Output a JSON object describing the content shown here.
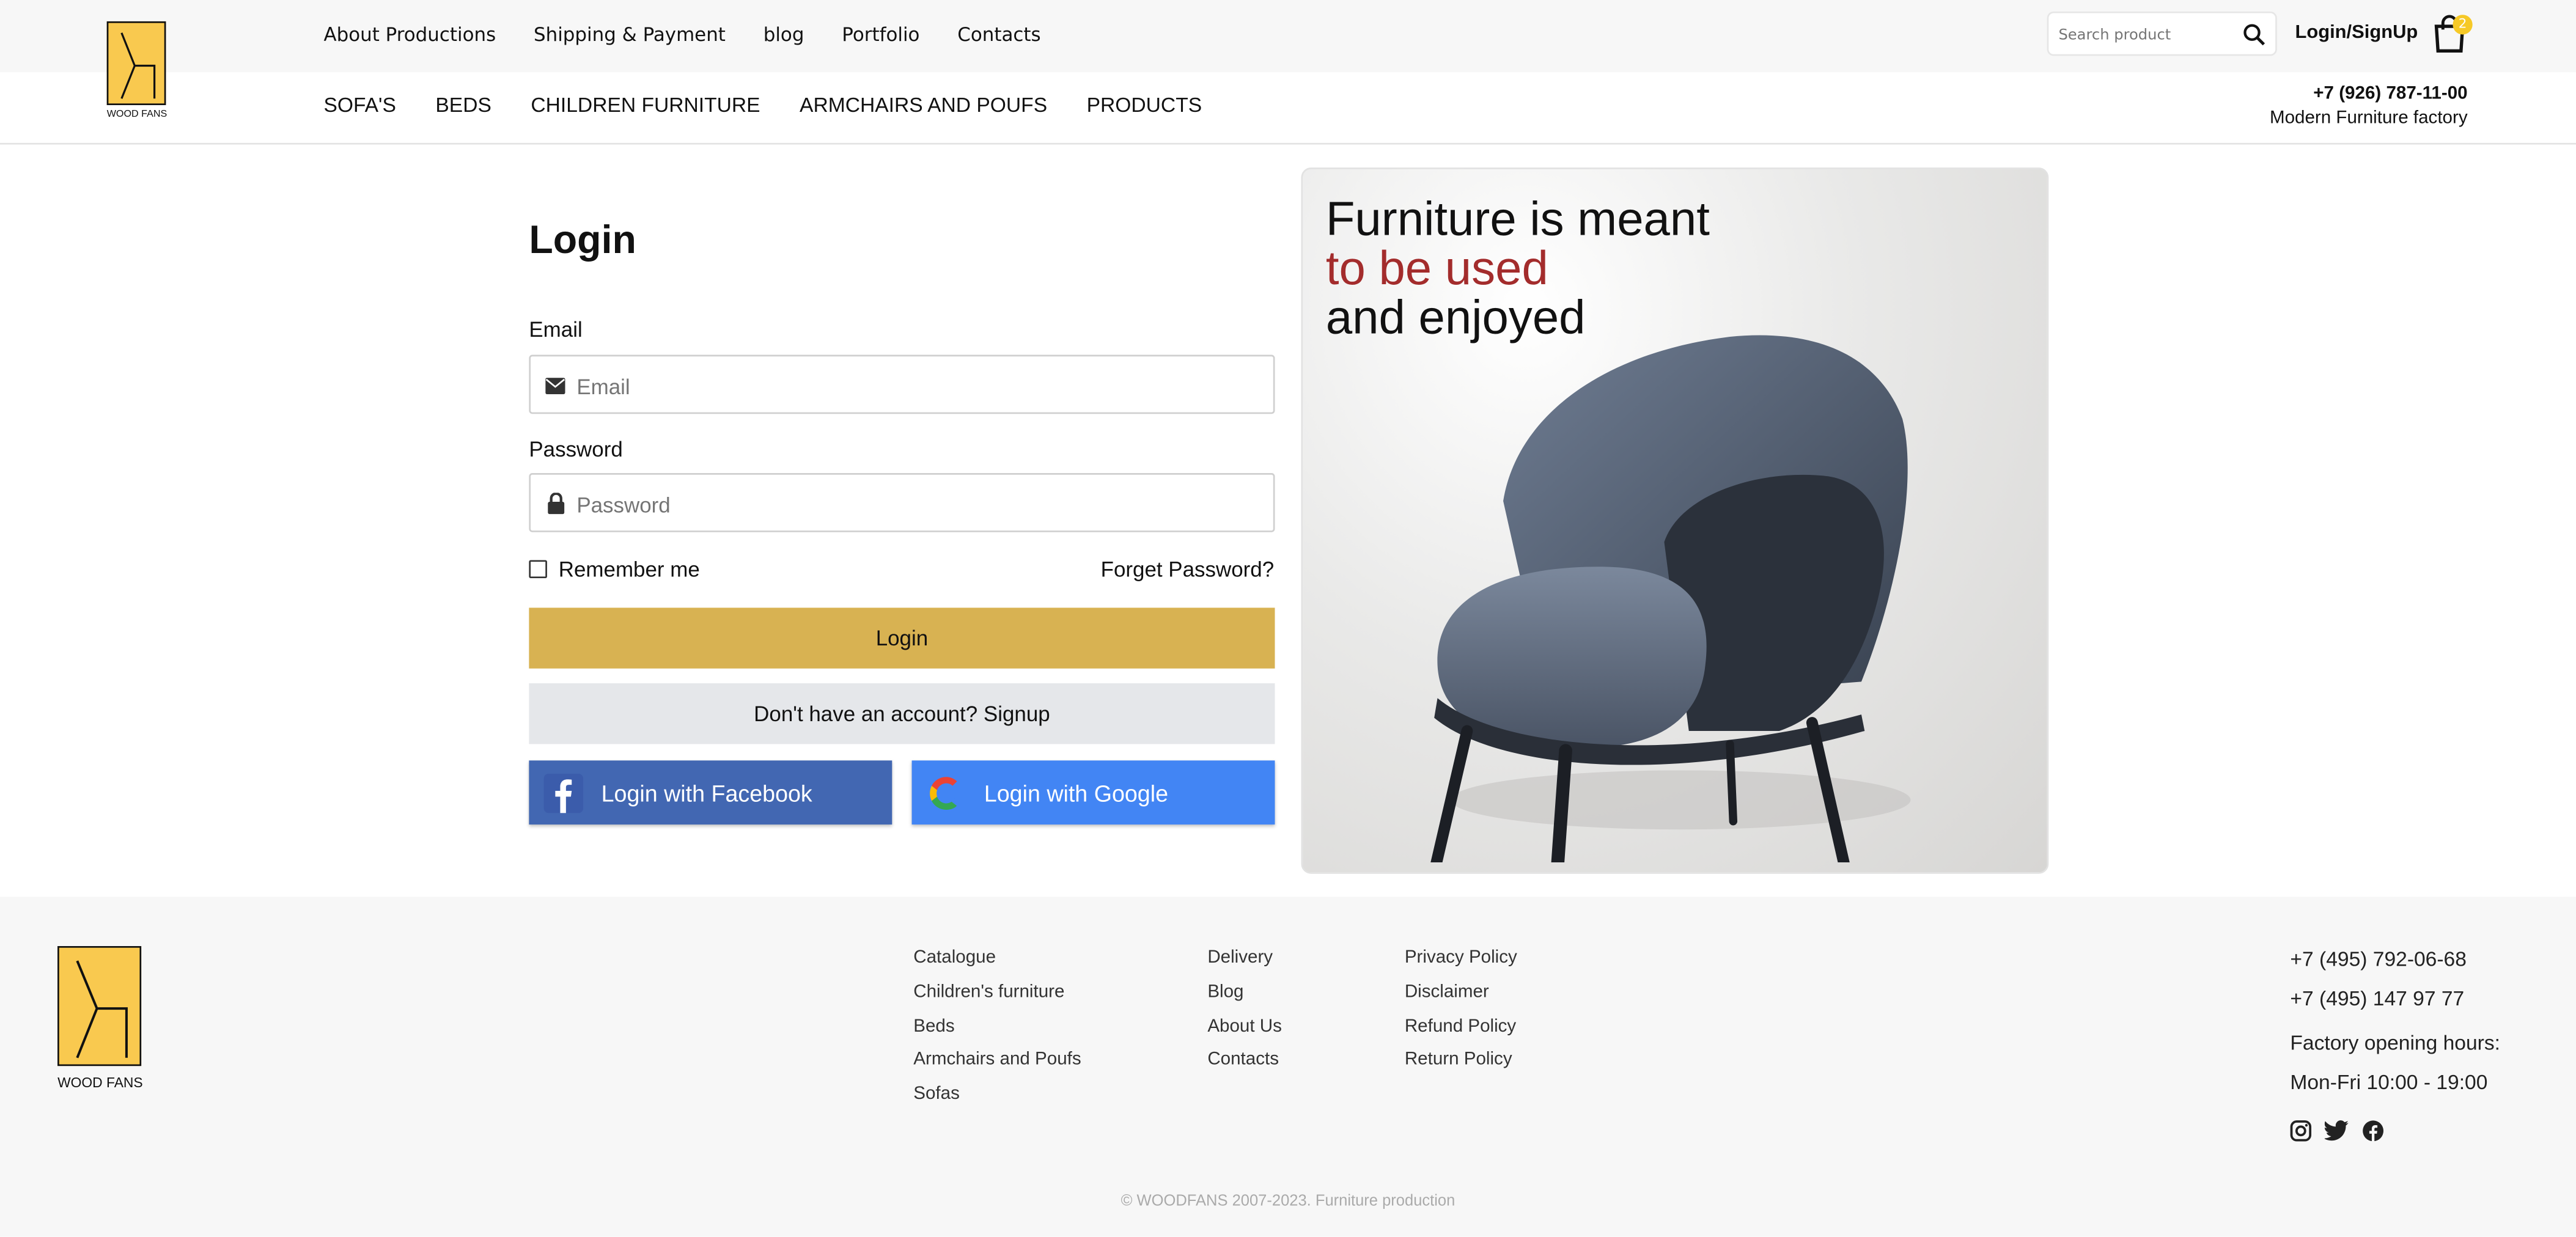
{
  "brand": {
    "logo_text": "WOOD FANS"
  },
  "header": {
    "top_nav": [
      "About Productions",
      "Shipping & Payment",
      "blog",
      "Portfolio",
      "Contacts"
    ],
    "search_placeholder": "Search product",
    "login_label": "Login/SignUp",
    "cart_count": "2",
    "phone": "+7 (926) 787-11-00",
    "factory": "Modern Furniture factory"
  },
  "categories": [
    "SOFA'S",
    "BEDS",
    "CHILDREN FURNITURE",
    "ARMCHAIRS AND POUFS",
    "PRODUCTS"
  ],
  "login": {
    "title": "Login",
    "email_label": "Email",
    "email_placeholder": "Email",
    "password_label": "Password",
    "password_placeholder": "Password",
    "remember": "Remember me",
    "forgot": "Forget Password?",
    "login_button": "Login",
    "signup_button": "Don't have an account? Signup",
    "facebook_button": "Login with Facebook",
    "google_button": "Login with Google"
  },
  "hero": {
    "line1": "Furniture is meant",
    "line2": "to be used",
    "line3": "and enjoyed",
    "accent_color": "#a32c2c"
  },
  "footer": {
    "logo_text": "WOOD FANS",
    "col1": [
      "Catalogue",
      "Children's furniture",
      "Beds",
      "Armchairs and Poufs",
      "Sofas"
    ],
    "col2": [
      "Delivery",
      "Blog",
      "About Us",
      "Contacts"
    ],
    "col3": [
      "Privacy Policy",
      "Disclaimer",
      "Refund Policy",
      "Return Policy"
    ],
    "phone1": "+7 (495) 792-06-68",
    "phone2": "+7 (495) 147 97 77",
    "hours_title": "Factory opening hours:",
    "hours": "Mon-Fri 10:00 - 19:00",
    "social_icons": [
      "instagram-icon",
      "twitter-icon",
      "facebook-icon"
    ],
    "copyright": "© WOODFANS 2007-2023. Furniture production"
  },
  "colors": {
    "brand_yellow": "#f9c94f",
    "login_button": "#d8b252",
    "facebook": "#4267b2",
    "google": "#4285f4"
  }
}
